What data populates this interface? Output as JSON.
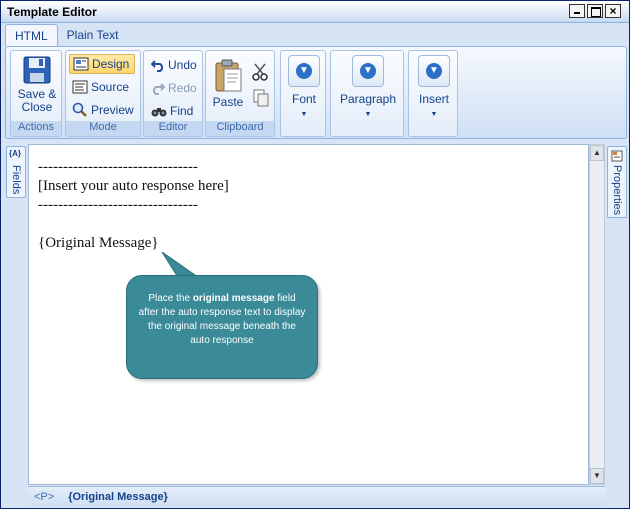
{
  "window": {
    "title": "Template Editor"
  },
  "tabs": [
    {
      "label": "HTML",
      "active": true
    },
    {
      "label": "Plain Text",
      "active": false
    }
  ],
  "ribbon": {
    "actions": {
      "label": "Actions",
      "save_close": "Save &\nClose"
    },
    "mode": {
      "label": "Mode",
      "design": "Design",
      "source": "Source",
      "preview": "Preview"
    },
    "editor": {
      "label": "Editor",
      "undo": "Undo",
      "redo": "Redo",
      "find": "Find"
    },
    "clipboard": {
      "label": "Clipboard",
      "paste": "Paste"
    },
    "font": {
      "label": "Font"
    },
    "paragraph": {
      "label": "Paragraph"
    },
    "insert": {
      "label": "Insert"
    }
  },
  "side_panels": {
    "left": "Fields",
    "left_icon_text": "{A}",
    "right": "Properties"
  },
  "editor_content": {
    "line1": "--------------------------------",
    "line2": "[Insert your auto response here]",
    "line3": "--------------------------------",
    "line4": "{Original Message}"
  },
  "callout": {
    "pre": "Place the ",
    "bold": "original message",
    "post": " field after the auto response text  to display the original message beneath the auto response"
  },
  "statusbar": {
    "tag": "<P>",
    "field": "{Original Message}"
  },
  "colors": {
    "accent": "#15428b",
    "callout": "#3a8a98",
    "ribbon": "#d6e4f5"
  }
}
